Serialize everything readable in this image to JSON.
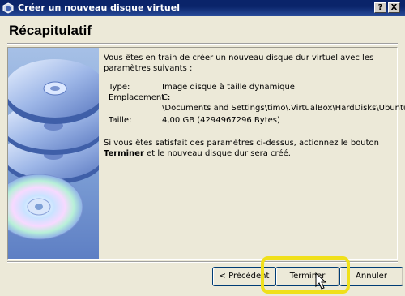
{
  "window": {
    "title": "Créer un nouveau disque virtuel",
    "help_label": "?",
    "close_label": "X"
  },
  "heading": "Récapitulatif",
  "intro": "Vous êtes en train de créer un nouveau disque dur virtuel avec les paramètres suivants :",
  "details": [
    {
      "label": "Type:",
      "value": "Image disque à taille dynamique"
    },
    {
      "label": "Emplacement :",
      "value": "C:"
    },
    {
      "label": "",
      "value": "\\Documents and Settings\\timo\\.VirtualBox\\HardDisks\\Ubuntu.vdi"
    },
    {
      "label": "Taille:",
      "value": "4,00 GB (4294967296 Bytes)"
    }
  ],
  "outro": {
    "before": "Si vous êtes satisfait des paramètres ci-dessus, actionnez le bouton ",
    "bold": "Terminer",
    "after": " et le nouveau disque dur sera créé."
  },
  "buttons": {
    "previous": "< Précédent",
    "finish": "Terminer",
    "cancel": "Annuler"
  },
  "colors": {
    "titlebar": "#0a246a",
    "highlight": "#f0e01a",
    "artwork": "#7ea0d6"
  },
  "icons": [
    "virtualbox-app-icon",
    "disc-stack-icon",
    "cd-icon",
    "mouse-cursor-icon"
  ]
}
